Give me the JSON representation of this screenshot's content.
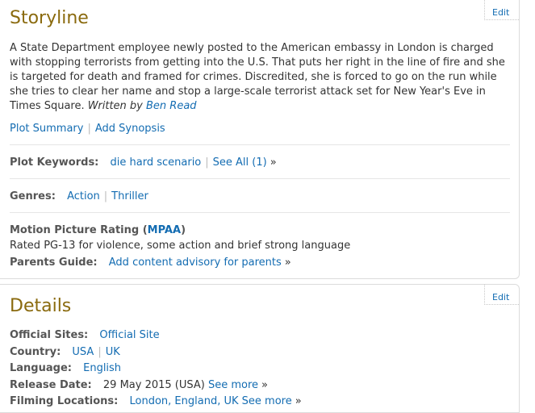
{
  "storyline": {
    "edit_label": "Edit",
    "title": "Storyline",
    "summary": "A State Department employee newly posted to the American embassy in London is charged with stopping terrorists from getting into the U.S. That puts her right in the line of fire and she is targeted for death and framed for crimes. Discredited, she is forced to go on the run while she tries to clear her name and stop a large-scale terrorist attack set for New Year's Eve in Times Square.",
    "written_by": "Written by",
    "author": "Ben Read",
    "plot_summary_link": "Plot Summary",
    "add_synopsis_link": "Add Synopsis",
    "plot_keywords": {
      "label": "Plot Keywords:",
      "keyword": "die hard scenario",
      "see_all": "See All (1)",
      "raquo": "»"
    },
    "genres": {
      "label": "Genres:",
      "items": [
        "Action",
        "Thriller"
      ]
    },
    "rating": {
      "label_prefix": "Motion Picture Rating (",
      "mpaa": "MPAA",
      "label_suffix": ")",
      "text": "Rated PG-13 for violence, some action and brief strong language"
    },
    "parents_guide": {
      "label": "Parents Guide:",
      "link": "Add content advisory for parents",
      "raquo": "»"
    }
  },
  "details": {
    "edit_label": "Edit",
    "title": "Details",
    "official_sites": {
      "label": "Official Sites:",
      "link": "Official Site"
    },
    "country": {
      "label": "Country:",
      "items": [
        "USA",
        "UK"
      ]
    },
    "language": {
      "label": "Language:",
      "link": "English"
    },
    "release_date": {
      "label": "Release Date:",
      "value": "29 May 2015 (USA)",
      "see_more": "See more",
      "raquo": "»"
    },
    "filming_locations": {
      "label": "Filming Locations:",
      "link": "London, England, UK",
      "see_more": "See more",
      "raquo": "»"
    }
  },
  "colors": {
    "heading": "#8a6a0e",
    "link": "#136cb2",
    "text": "#333333",
    "border": "#dcdcdc"
  }
}
